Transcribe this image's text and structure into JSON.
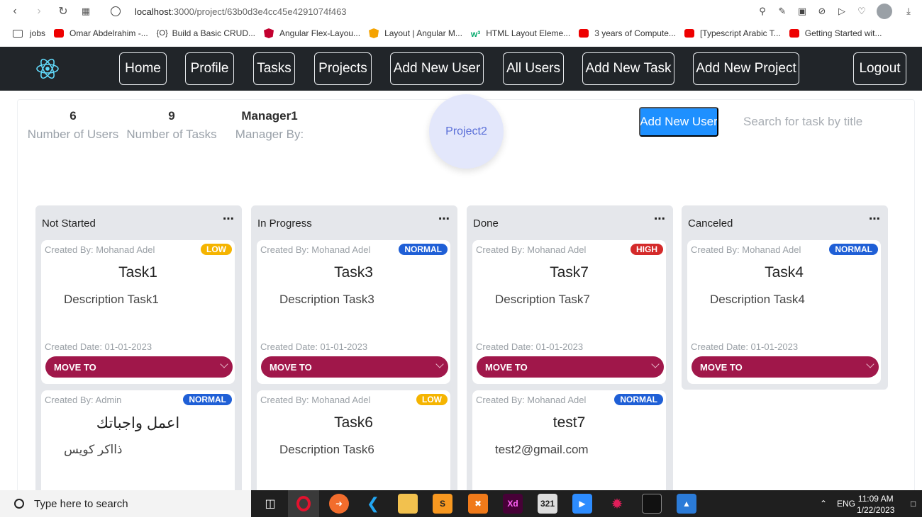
{
  "browser": {
    "url_host": "localhost",
    "url_path": ":3000/project/63b0d3e4cc45e4291074f463",
    "bookmarks": [
      {
        "label": "jobs",
        "icon": "folder-icon"
      },
      {
        "label": "Omar Abdelrahim -...",
        "icon": "youtube-icon"
      },
      {
        "label": "Build a Basic CRUD...",
        "icon": "code-icon"
      },
      {
        "label": "Angular Flex-Layou...",
        "icon": "angular-icon"
      },
      {
        "label": "Layout | Angular M...",
        "icon": "shield-icon"
      },
      {
        "label": "HTML Layout Eleme...",
        "icon": "w3-icon"
      },
      {
        "label": "3 years of Compute...",
        "icon": "youtube-icon"
      },
      {
        "label": "[Typescript Arabic T...",
        "icon": "youtube-icon"
      },
      {
        "label": "Getting Started wit...",
        "icon": "youtube-icon"
      }
    ]
  },
  "nav": {
    "links": [
      "Home",
      "Profile",
      "Tasks",
      "Projects",
      "Add New User",
      "All Users",
      "Add New Task",
      "Add New Project"
    ],
    "logout": "Logout"
  },
  "project": {
    "stats": [
      {
        "value": "6",
        "label": "Number of Users"
      },
      {
        "value": "9",
        "label": "Number of Tasks"
      },
      {
        "value": "Manager1",
        "label": "Manager By:"
      }
    ],
    "name": "Project2",
    "add_user_label": "Add New User",
    "search_placeholder": "Search for task by title"
  },
  "board": {
    "move_to_label": "MOVE TO",
    "columns": [
      {
        "title": "Not Started",
        "cards": [
          {
            "created_by": "Created By: Mohanad Adel",
            "priority": "LOW",
            "title": "Task1",
            "description": "Description Task1",
            "date": "Created Date: 01-01-2023"
          },
          {
            "created_by": "Created By: Admin",
            "priority": "NORMAL",
            "title": "اعمل واجباتك",
            "description": "ذااكر كويس",
            "date": ""
          }
        ]
      },
      {
        "title": "In Progress",
        "cards": [
          {
            "created_by": "Created By: Mohanad Adel",
            "priority": "NORMAL",
            "title": "Task3",
            "description": "Description Task3",
            "date": "Created Date: 01-01-2023"
          },
          {
            "created_by": "Created By: Mohanad Adel",
            "priority": "LOW",
            "title": "Task6",
            "description": "Description Task6",
            "date": ""
          }
        ]
      },
      {
        "title": "Done",
        "cards": [
          {
            "created_by": "Created By: Mohanad Adel",
            "priority": "HIGH",
            "title": "Task7",
            "description": "Description Task7",
            "date": "Created Date: 01-01-2023"
          },
          {
            "created_by": "Created By: Mohanad Adel",
            "priority": "NORMAL",
            "title": "test7",
            "description": "test2@gmail.com",
            "date": ""
          }
        ]
      },
      {
        "title": "Canceled",
        "cards": [
          {
            "created_by": "Created By: Mohanad Adel",
            "priority": "NORMAL",
            "title": "Task4",
            "description": "Description Task4",
            "date": "Created Date: 01-01-2023"
          }
        ]
      }
    ]
  },
  "colors": {
    "navbar": "#212529",
    "accent_blue": "#1e90ff",
    "move_to": "#a0174a",
    "priority_low": "#f5b400",
    "priority_normal": "#1f5fd6",
    "priority_high": "#d42a2a"
  },
  "taskbar": {
    "search_placeholder": "Type here to search",
    "lang": "ENG",
    "time": "11:09 AM",
    "date": "1/22/2023"
  }
}
